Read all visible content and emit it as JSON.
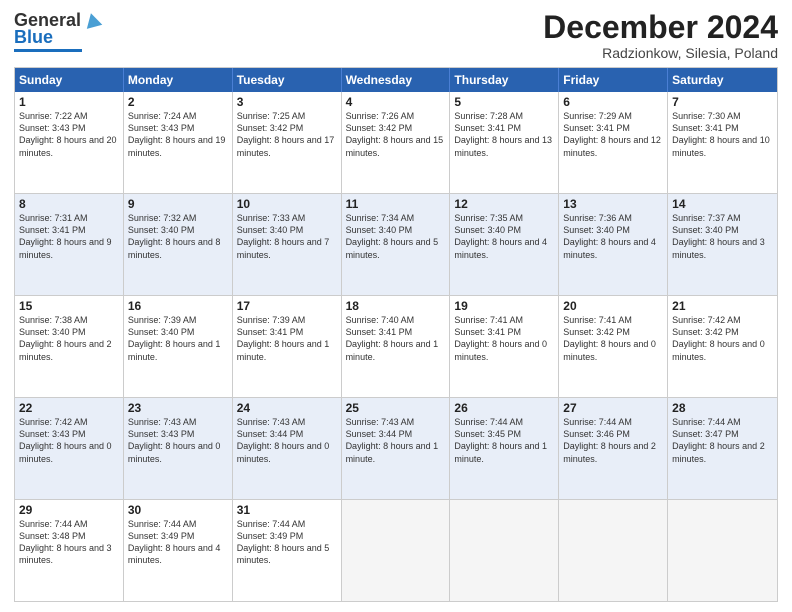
{
  "header": {
    "logo_line1": "General",
    "logo_line2": "Blue",
    "month_title": "December 2024",
    "location": "Radzionkow, Silesia, Poland"
  },
  "weekdays": [
    "Sunday",
    "Monday",
    "Tuesday",
    "Wednesday",
    "Thursday",
    "Friday",
    "Saturday"
  ],
  "rows": [
    [
      {
        "day": "1",
        "sunrise": "7:22 AM",
        "sunset": "3:43 PM",
        "daylight": "8 hours and 20 minutes."
      },
      {
        "day": "2",
        "sunrise": "7:24 AM",
        "sunset": "3:43 PM",
        "daylight": "8 hours and 19 minutes."
      },
      {
        "day": "3",
        "sunrise": "7:25 AM",
        "sunset": "3:42 PM",
        "daylight": "8 hours and 17 minutes."
      },
      {
        "day": "4",
        "sunrise": "7:26 AM",
        "sunset": "3:42 PM",
        "daylight": "8 hours and 15 minutes."
      },
      {
        "day": "5",
        "sunrise": "7:28 AM",
        "sunset": "3:41 PM",
        "daylight": "8 hours and 13 minutes."
      },
      {
        "day": "6",
        "sunrise": "7:29 AM",
        "sunset": "3:41 PM",
        "daylight": "8 hours and 12 minutes."
      },
      {
        "day": "7",
        "sunrise": "7:30 AM",
        "sunset": "3:41 PM",
        "daylight": "8 hours and 10 minutes."
      }
    ],
    [
      {
        "day": "8",
        "sunrise": "7:31 AM",
        "sunset": "3:41 PM",
        "daylight": "8 hours and 9 minutes."
      },
      {
        "day": "9",
        "sunrise": "7:32 AM",
        "sunset": "3:40 PM",
        "daylight": "8 hours and 8 minutes."
      },
      {
        "day": "10",
        "sunrise": "7:33 AM",
        "sunset": "3:40 PM",
        "daylight": "8 hours and 7 minutes."
      },
      {
        "day": "11",
        "sunrise": "7:34 AM",
        "sunset": "3:40 PM",
        "daylight": "8 hours and 5 minutes."
      },
      {
        "day": "12",
        "sunrise": "7:35 AM",
        "sunset": "3:40 PM",
        "daylight": "8 hours and 4 minutes."
      },
      {
        "day": "13",
        "sunrise": "7:36 AM",
        "sunset": "3:40 PM",
        "daylight": "8 hours and 4 minutes."
      },
      {
        "day": "14",
        "sunrise": "7:37 AM",
        "sunset": "3:40 PM",
        "daylight": "8 hours and 3 minutes."
      }
    ],
    [
      {
        "day": "15",
        "sunrise": "7:38 AM",
        "sunset": "3:40 PM",
        "daylight": "8 hours and 2 minutes."
      },
      {
        "day": "16",
        "sunrise": "7:39 AM",
        "sunset": "3:40 PM",
        "daylight": "8 hours and 1 minute."
      },
      {
        "day": "17",
        "sunrise": "7:39 AM",
        "sunset": "3:41 PM",
        "daylight": "8 hours and 1 minute."
      },
      {
        "day": "18",
        "sunrise": "7:40 AM",
        "sunset": "3:41 PM",
        "daylight": "8 hours and 1 minute."
      },
      {
        "day": "19",
        "sunrise": "7:41 AM",
        "sunset": "3:41 PM",
        "daylight": "8 hours and 0 minutes."
      },
      {
        "day": "20",
        "sunrise": "7:41 AM",
        "sunset": "3:42 PM",
        "daylight": "8 hours and 0 minutes."
      },
      {
        "day": "21",
        "sunrise": "7:42 AM",
        "sunset": "3:42 PM",
        "daylight": "8 hours and 0 minutes."
      }
    ],
    [
      {
        "day": "22",
        "sunrise": "7:42 AM",
        "sunset": "3:43 PM",
        "daylight": "8 hours and 0 minutes."
      },
      {
        "day": "23",
        "sunrise": "7:43 AM",
        "sunset": "3:43 PM",
        "daylight": "8 hours and 0 minutes."
      },
      {
        "day": "24",
        "sunrise": "7:43 AM",
        "sunset": "3:44 PM",
        "daylight": "8 hours and 0 minutes."
      },
      {
        "day": "25",
        "sunrise": "7:43 AM",
        "sunset": "3:44 PM",
        "daylight": "8 hours and 1 minute."
      },
      {
        "day": "26",
        "sunrise": "7:44 AM",
        "sunset": "3:45 PM",
        "daylight": "8 hours and 1 minute."
      },
      {
        "day": "27",
        "sunrise": "7:44 AM",
        "sunset": "3:46 PM",
        "daylight": "8 hours and 2 minutes."
      },
      {
        "day": "28",
        "sunrise": "7:44 AM",
        "sunset": "3:47 PM",
        "daylight": "8 hours and 2 minutes."
      }
    ],
    [
      {
        "day": "29",
        "sunrise": "7:44 AM",
        "sunset": "3:48 PM",
        "daylight": "8 hours and 3 minutes."
      },
      {
        "day": "30",
        "sunrise": "7:44 AM",
        "sunset": "3:49 PM",
        "daylight": "8 hours and 4 minutes."
      },
      {
        "day": "31",
        "sunrise": "7:44 AM",
        "sunset": "3:49 PM",
        "daylight": "8 hours and 5 minutes."
      },
      null,
      null,
      null,
      null
    ]
  ],
  "labels": {
    "sunrise": "Sunrise:",
    "sunset": "Sunset:",
    "daylight": "Daylight hours"
  }
}
